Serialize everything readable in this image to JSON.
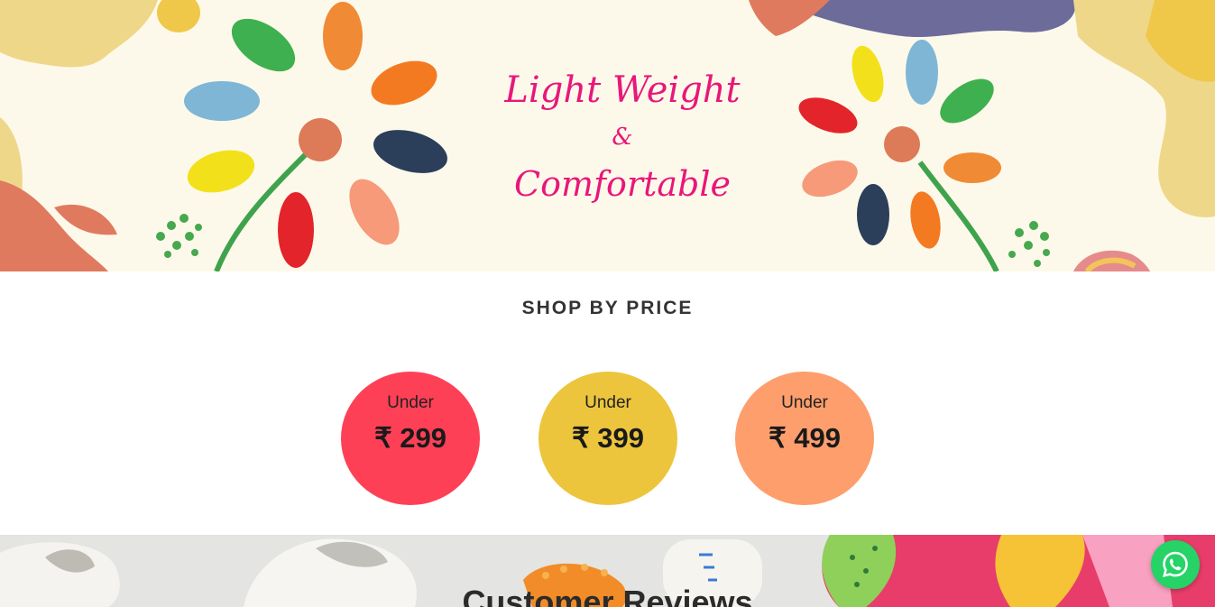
{
  "hero": {
    "headline_line1": "Light Weight",
    "headline_amp": "&",
    "headline_line2": "Comfortable",
    "accent_color": "#e8177a"
  },
  "shop_by_price": {
    "title": "SHOP BY PRICE",
    "items": [
      {
        "prefix": "Under",
        "value": "₹ 299",
        "color": "#fe4057"
      },
      {
        "prefix": "Under",
        "value": "₹ 399",
        "color": "#ecc53c"
      },
      {
        "prefix": "Under",
        "value": "₹ 499",
        "color": "#fd9e6c"
      }
    ]
  },
  "reviews": {
    "title": "Customer Reviews"
  },
  "whatsapp": {
    "icon": "whatsapp-icon",
    "color": "#25d366"
  }
}
